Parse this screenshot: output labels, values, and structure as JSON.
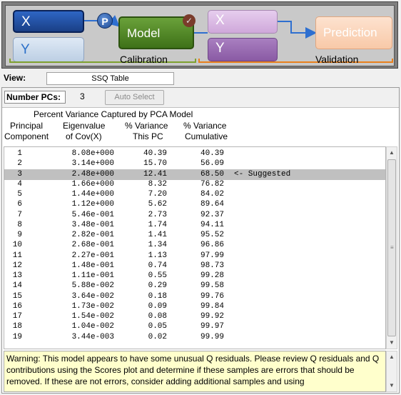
{
  "workflow": {
    "x_cal": "X",
    "y_cal": "Y",
    "p_badge": "P",
    "model": "Model",
    "x_val": "X",
    "y_val": "Y",
    "prediction": "Prediction",
    "calibration_label": "Calibration",
    "validation_label": "Validation",
    "colors": {
      "model": "#4f8a25",
      "x_cal": "#1f4c9f",
      "prediction": "#f9d3b8",
      "calibration_bracket": "#7ea12f",
      "validation_bracket": "#e8801d"
    }
  },
  "view": {
    "label": "View:",
    "value": "SSQ Table"
  },
  "pcs": {
    "label": "Number PCs:",
    "value": "3",
    "auto_select": "Auto Select"
  },
  "table": {
    "title": "Percent Variance Captured by PCA Model",
    "headers": {
      "pc_l1": "Principal",
      "pc_l2": "Component",
      "eig_l1": "Eigenvalue",
      "eig_l2": "of Cov(X)",
      "var_l1": "% Variance",
      "var_l2": "This  PC",
      "cum_l1": "% Variance",
      "cum_l2": "Cumulative"
    },
    "rows": [
      {
        "pc": "1",
        "eig": "8.08e+000",
        "var": "40.39",
        "cum": "40.39",
        "note": ""
      },
      {
        "pc": "2",
        "eig": "3.14e+000",
        "var": "15.70",
        "cum": "56.09",
        "note": ""
      },
      {
        "pc": "3",
        "eig": "2.48e+000",
        "var": "12.41",
        "cum": "68.50",
        "note": "<- Suggested"
      },
      {
        "pc": "4",
        "eig": "1.66e+000",
        "var": "8.32",
        "cum": "76.82",
        "note": ""
      },
      {
        "pc": "5",
        "eig": "1.44e+000",
        "var": "7.20",
        "cum": "84.02",
        "note": ""
      },
      {
        "pc": "6",
        "eig": "1.12e+000",
        "var": "5.62",
        "cum": "89.64",
        "note": ""
      },
      {
        "pc": "7",
        "eig": "5.46e-001",
        "var": "2.73",
        "cum": "92.37",
        "note": ""
      },
      {
        "pc": "8",
        "eig": "3.48e-001",
        "var": "1.74",
        "cum": "94.11",
        "note": ""
      },
      {
        "pc": "9",
        "eig": "2.82e-001",
        "var": "1.41",
        "cum": "95.52",
        "note": ""
      },
      {
        "pc": "10",
        "eig": "2.68e-001",
        "var": "1.34",
        "cum": "96.86",
        "note": ""
      },
      {
        "pc": "11",
        "eig": "2.27e-001",
        "var": "1.13",
        "cum": "97.99",
        "note": ""
      },
      {
        "pc": "12",
        "eig": "1.48e-001",
        "var": "0.74",
        "cum": "98.73",
        "note": ""
      },
      {
        "pc": "13",
        "eig": "1.11e-001",
        "var": "0.55",
        "cum": "99.28",
        "note": ""
      },
      {
        "pc": "14",
        "eig": "5.88e-002",
        "var": "0.29",
        "cum": "99.58",
        "note": ""
      },
      {
        "pc": "15",
        "eig": "3.64e-002",
        "var": "0.18",
        "cum": "99.76",
        "note": ""
      },
      {
        "pc": "16",
        "eig": "1.73e-002",
        "var": "0.09",
        "cum": "99.84",
        "note": ""
      },
      {
        "pc": "17",
        "eig": "1.54e-002",
        "var": "0.08",
        "cum": "99.92",
        "note": ""
      },
      {
        "pc": "18",
        "eig": "1.04e-002",
        "var": "0.05",
        "cum": "99.97",
        "note": ""
      },
      {
        "pc": "19",
        "eig": "3.44e-003",
        "var": "0.02",
        "cum": "99.99",
        "note": ""
      }
    ],
    "selected_pc": "3"
  },
  "warning": "Warning: This model appears to have some unusual Q residuals. Please review Q residuals and Q contributions using the Scores plot and determine if these samples are errors that should be removed. If these are not errors, consider adding additional samples and using"
}
